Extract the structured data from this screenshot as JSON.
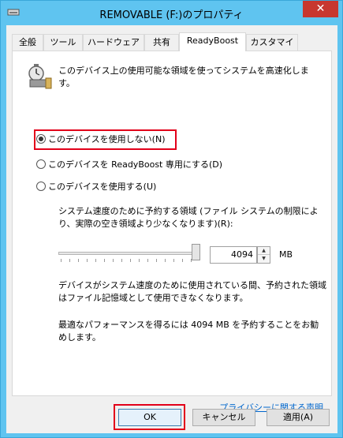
{
  "window": {
    "title": "REMOVABLE (F:)のプロパティ",
    "close_glyph": "✕"
  },
  "tabs": [
    {
      "label": "全般"
    },
    {
      "label": "ツール"
    },
    {
      "label": "ハードウェア"
    },
    {
      "label": "共有"
    },
    {
      "label": "ReadyBoost",
      "active": true
    },
    {
      "label": "カスタマイズ"
    }
  ],
  "readyboost": {
    "description": "このデバイス上の使用可能な領域を使ってシステムを高速化します。",
    "options": [
      {
        "label": "このデバイスを使用しない(N)",
        "checked": true
      },
      {
        "label": "このデバイスを ReadyBoost 専用にする(D)",
        "checked": false
      },
      {
        "label": "このデバイスを使用する(U)",
        "checked": false
      }
    ],
    "reserve_label": "システム速度のために予約する領域 (ファイル システムの制限により、実際の空き領域より少なくなります)(R):",
    "reserve_value": "4094",
    "reserve_unit": "MB",
    "info_1": "デバイスがシステム速度のために使用されている間、予約された領域はファイル記憶域として使用できなくなります。",
    "info_2": "最適なパフォーマンスを得るには 4094 MB を予約することをお勧めします。",
    "privacy_link": "プライバシーに関する声明"
  },
  "buttons": {
    "ok": "OK",
    "cancel": "キャンセル",
    "apply": "適用(A)"
  },
  "colors": {
    "title_bar": "#5fc4f0",
    "close_button": "#c7372f",
    "highlight": "#e2001a",
    "link": "#0066cc"
  }
}
